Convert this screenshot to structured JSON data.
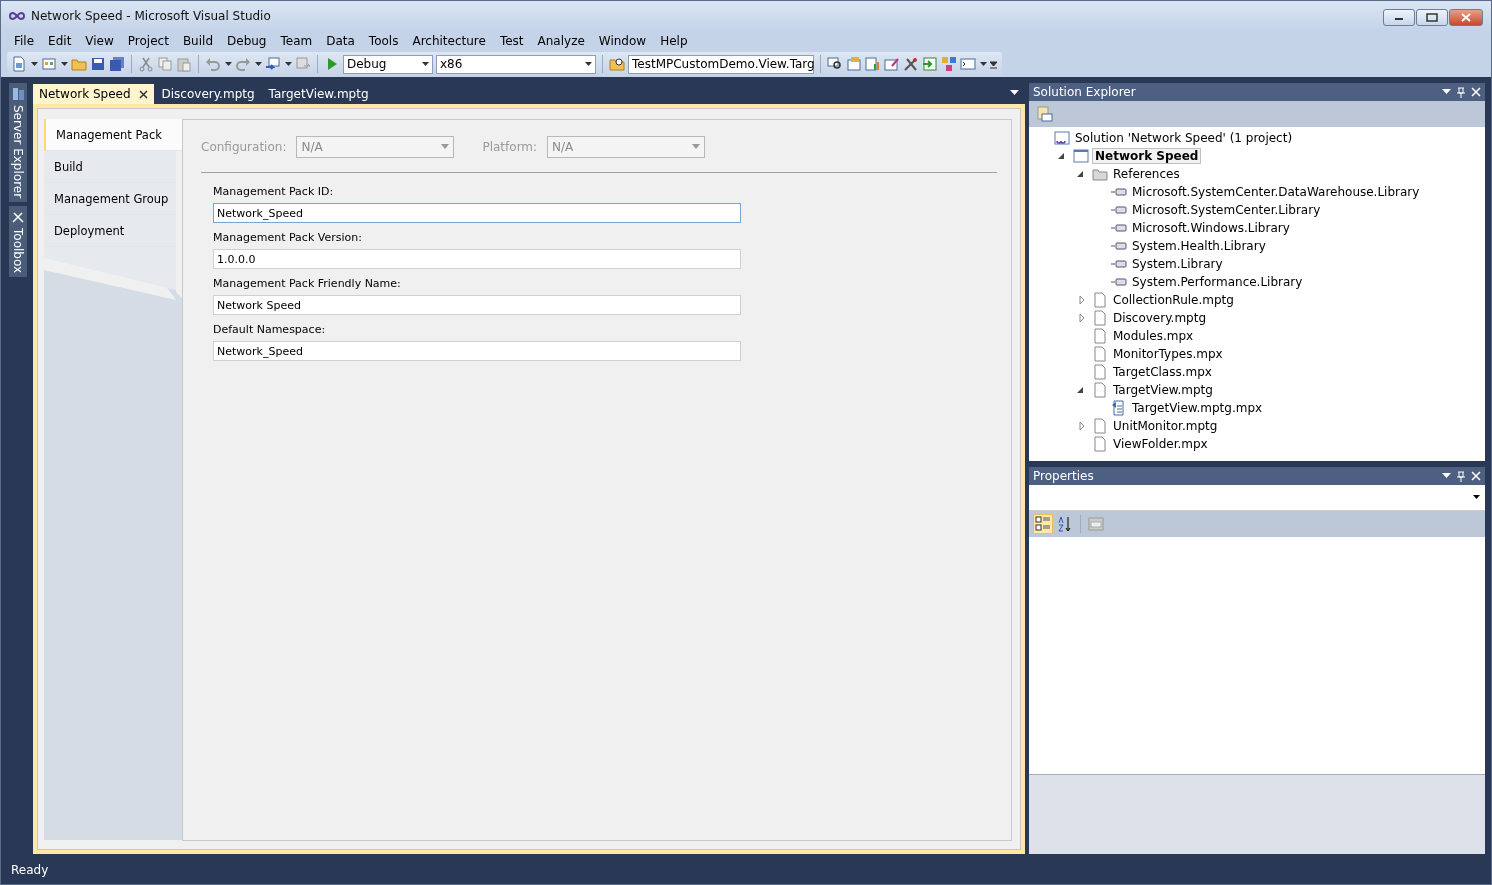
{
  "window": {
    "title": "Network Speed - Microsoft Visual Studio"
  },
  "menu": [
    "File",
    "Edit",
    "View",
    "Project",
    "Build",
    "Debug",
    "Team",
    "Data",
    "Tools",
    "Architecture",
    "Test",
    "Analyze",
    "Window",
    "Help"
  ],
  "toolbar": {
    "configuration": "Debug",
    "platform": "x86",
    "startup_item": "TestMPCustomDemo.View.Targ"
  },
  "side_tabs": [
    "Server Explorer",
    "Toolbox"
  ],
  "document_tabs": [
    {
      "label": "Network Speed",
      "selected": true
    },
    {
      "label": "Discovery.mptg",
      "selected": false
    },
    {
      "label": "TargetView.mptg",
      "selected": false
    }
  ],
  "property_pages": [
    {
      "label": "Management Pack",
      "selected": true
    },
    {
      "label": "Build",
      "selected": false
    },
    {
      "label": "Management Group",
      "selected": false
    },
    {
      "label": "Deployment",
      "selected": false
    }
  ],
  "selectors": [
    {
      "label": "Configuration:",
      "value": "N/A",
      "disabled": true
    },
    {
      "label": "Platform:",
      "value": "N/A",
      "disabled": true
    }
  ],
  "fields": [
    {
      "label": "Management Pack ID:",
      "value": "Network_Speed",
      "focused": true
    },
    {
      "label": "Management Pack Version:",
      "value": "1.0.0.0",
      "focused": false
    },
    {
      "label": "Management Pack Friendly Name:",
      "value": "Network Speed",
      "focused": false
    },
    {
      "label": "Default Namespace:",
      "value": "Network_Speed",
      "focused": false
    }
  ],
  "solution_explorer": {
    "title": "Solution Explorer",
    "tree": [
      {
        "kind": "solution",
        "text": "Solution 'Network Speed' (1 project)",
        "selected": false,
        "children": [
          {
            "kind": "project",
            "text": "Network Speed",
            "selected": true,
            "expanded": true,
            "children": [
              {
                "kind": "folder",
                "text": "References",
                "selected": false,
                "expanded": true,
                "children": [
                  {
                    "kind": "reference",
                    "text": "Microsoft.SystemCenter.DataWarehouse.Library",
                    "selected": false
                  },
                  {
                    "kind": "reference",
                    "text": "Microsoft.SystemCenter.Library",
                    "selected": false
                  },
                  {
                    "kind": "reference",
                    "text": "Microsoft.Windows.Library",
                    "selected": false
                  },
                  {
                    "kind": "reference",
                    "text": "System.Health.Library",
                    "selected": false
                  },
                  {
                    "kind": "reference",
                    "text": "System.Library",
                    "selected": false
                  },
                  {
                    "kind": "reference",
                    "text": "System.Performance.Library",
                    "selected": false
                  }
                ]
              },
              {
                "kind": "file",
                "text": "CollectionRule.mptg",
                "selected": false,
                "expanded": false
              },
              {
                "kind": "file",
                "text": "Discovery.mptg",
                "selected": false,
                "expanded": false
              },
              {
                "kind": "file",
                "text": "Modules.mpx",
                "selected": false
              },
              {
                "kind": "file",
                "text": "MonitorTypes.mpx",
                "selected": false
              },
              {
                "kind": "file",
                "text": "TargetClass.mpx",
                "selected": false
              },
              {
                "kind": "file",
                "text": "TargetView.mptg",
                "selected": false,
                "expanded": true,
                "children": [
                  {
                    "kind": "generated",
                    "text": "TargetView.mptg.mpx",
                    "selected": false
                  }
                ]
              },
              {
                "kind": "file",
                "text": "UnitMonitor.mptg",
                "selected": false,
                "expanded": false
              },
              {
                "kind": "file",
                "text": "ViewFolder.mpx",
                "selected": false
              }
            ]
          }
        ]
      }
    ]
  },
  "properties": {
    "title": "Properties"
  },
  "status_bar": {
    "text": "Ready"
  }
}
